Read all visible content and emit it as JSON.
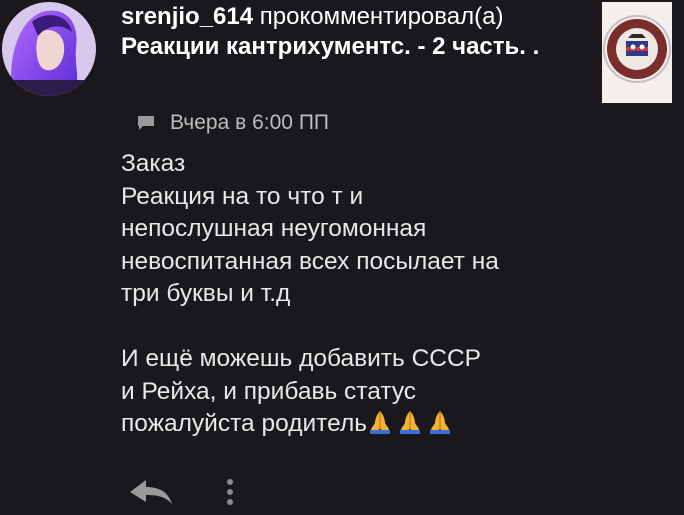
{
  "comment": {
    "username": "srenjio_614",
    "action": "прокомментировал(а)",
    "post_title": "Реакции кантрихументс. - 2 часть. .",
    "timestamp": "Вчера в 6:00 ПП",
    "body_lines": [
      "Заказ",
      "Реакция на то что т и",
      "непослушная неугомонная",
      "невоспитанная всех посылает на",
      "три буквы и т.д",
      "",
      "И ещё можешь добавить СССР",
      "и Рейха, и прибавь статус",
      "пожалуйста родитель"
    ],
    "trailing_emoji": [
      "praying-hands",
      "praying-hands",
      "praying-hands"
    ],
    "icons": {
      "comment": "comment-icon",
      "reply": "reply-icon",
      "more": "more-vertical-icon"
    }
  }
}
